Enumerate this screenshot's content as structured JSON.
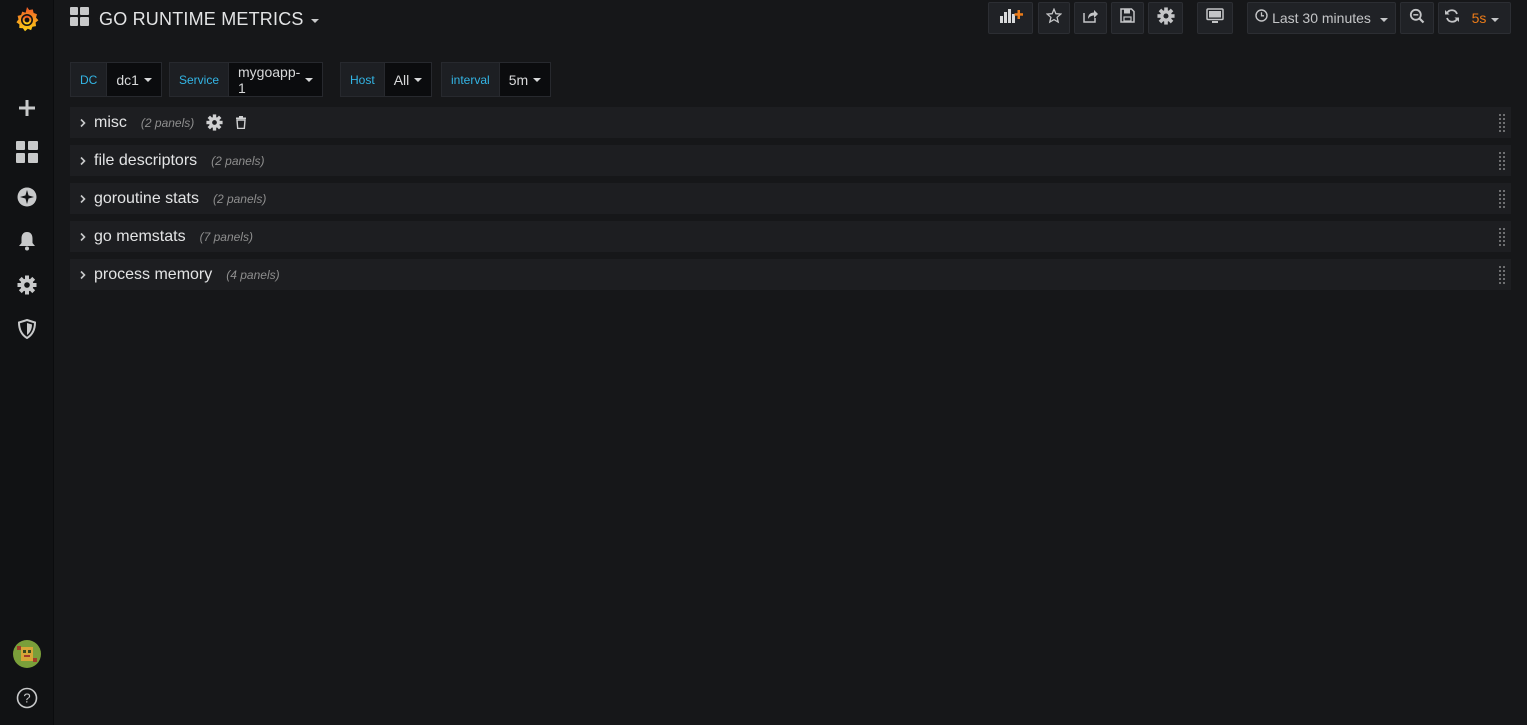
{
  "dashboard": {
    "title": "GO RUNTIME METRICS"
  },
  "toolbar": {
    "time_range": "Last 30 minutes",
    "refresh_interval": "5s"
  },
  "variables": [
    {
      "label": "DC",
      "value": "dc1"
    },
    {
      "label": "Service",
      "value": "mygoapp-1"
    },
    {
      "label": "Host",
      "value": "All"
    },
    {
      "label": "interval",
      "value": "5m"
    }
  ],
  "rows": [
    {
      "title": "misc",
      "count": "(2 panels)"
    },
    {
      "title": "file descriptors",
      "count": "(2 panels)"
    },
    {
      "title": "goroutine stats",
      "count": "(2 panels)"
    },
    {
      "title": "go memstats",
      "count": "(7 panels)"
    },
    {
      "title": "process memory",
      "count": "(4 panels)"
    }
  ],
  "colors": {
    "accent_orange": "#eb7b18",
    "variable_label": "#33b5e5",
    "background": "#161719"
  },
  "icons": {
    "sidebar": [
      "grafana-logo-icon",
      "plus-icon",
      "dashboards-icon",
      "explore-icon",
      "bell-icon",
      "gear-icon",
      "shield-icon",
      "avatar",
      "help-icon"
    ],
    "toolbar": [
      "add-panel-icon",
      "star-icon",
      "share-icon",
      "save-icon",
      "gear-icon",
      "tv-icon",
      "clock-icon",
      "zoom-out-icon",
      "refresh-icon"
    ]
  }
}
